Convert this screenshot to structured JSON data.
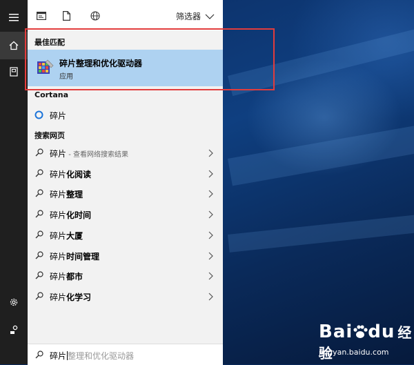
{
  "topbar": {
    "filter_label": "筛选器"
  },
  "sections": {
    "best_match": "最佳匹配",
    "cortana": "Cortana",
    "web": "搜索网页"
  },
  "best_match": {
    "title": "碎片整理和优化驱动器",
    "subtitle": "应用"
  },
  "cortana": {
    "item": "碎片"
  },
  "web_results": [
    {
      "prefix": "碎片",
      "bold": "",
      "suffix": " - 查看网络搜索结果"
    },
    {
      "prefix": "碎片",
      "bold": "化阅读",
      "suffix": ""
    },
    {
      "prefix": "碎片",
      "bold": "整理",
      "suffix": ""
    },
    {
      "prefix": "碎片",
      "bold": "化时间",
      "suffix": ""
    },
    {
      "prefix": "碎片",
      "bold": "大厦",
      "suffix": ""
    },
    {
      "prefix": "碎片",
      "bold": "时间管理",
      "suffix": ""
    },
    {
      "prefix": "碎片",
      "bold": "都市",
      "suffix": ""
    },
    {
      "prefix": "碎片",
      "bold": "化学习",
      "suffix": ""
    }
  ],
  "search": {
    "typed": "碎片",
    "completion": "整理和优化驱动器"
  },
  "watermark": {
    "logo": "Bai",
    "logo_end": "du",
    "word": "经验",
    "url": "jingyan.baidu.com"
  },
  "colors": {
    "highlight": "#aed2f1",
    "annotation": "#e23c3c",
    "rail": "#1f1f1f"
  }
}
